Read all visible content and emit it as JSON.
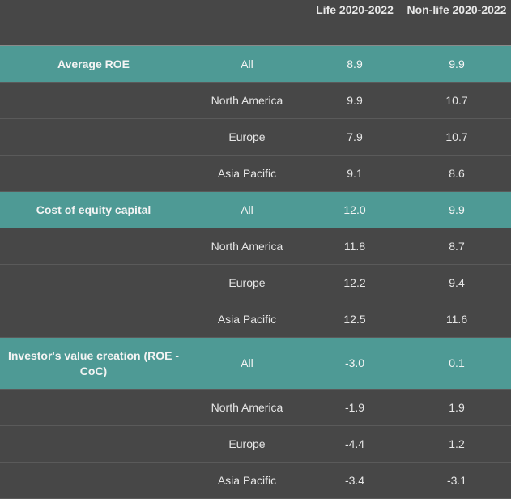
{
  "columns": {
    "label": "",
    "region": "",
    "life": "Life 2020-2022",
    "nonlife": "Non-life 2020-2022"
  },
  "rows": [
    {
      "group": "Average ROE",
      "region": "All",
      "life": "8.9",
      "nonlife": "9.9"
    },
    {
      "group": "",
      "region": "North America",
      "life": "9.9",
      "nonlife": "10.7"
    },
    {
      "group": "",
      "region": "Europe",
      "life": "7.9",
      "nonlife": "10.7"
    },
    {
      "group": "",
      "region": "Asia Pacific",
      "life": "9.1",
      "nonlife": "8.6"
    },
    {
      "group": "Cost of equity capital",
      "region": "All",
      "life": "12.0",
      "nonlife": "9.9"
    },
    {
      "group": "",
      "region": "North America",
      "life": "11.8",
      "nonlife": "8.7"
    },
    {
      "group": "",
      "region": "Europe",
      "life": "12.2",
      "nonlife": "9.4"
    },
    {
      "group": "",
      "region": "Asia Pacific",
      "life": "12.5",
      "nonlife": "11.6"
    },
    {
      "group": "Investor's value creation (ROE - CoC)",
      "region": "All",
      "life": "-3.0",
      "nonlife": "0.1"
    },
    {
      "group": "",
      "region": "North America",
      "life": "-1.9",
      "nonlife": "1.9"
    },
    {
      "group": "",
      "region": "Europe",
      "life": "-4.4",
      "nonlife": "1.2"
    },
    {
      "group": "",
      "region": "Asia Pacific",
      "life": "-3.4",
      "nonlife": "-3.1"
    }
  ],
  "colors": {
    "background": "#474747",
    "group_row": "#4e9a95",
    "text": "#e6e6e6"
  }
}
